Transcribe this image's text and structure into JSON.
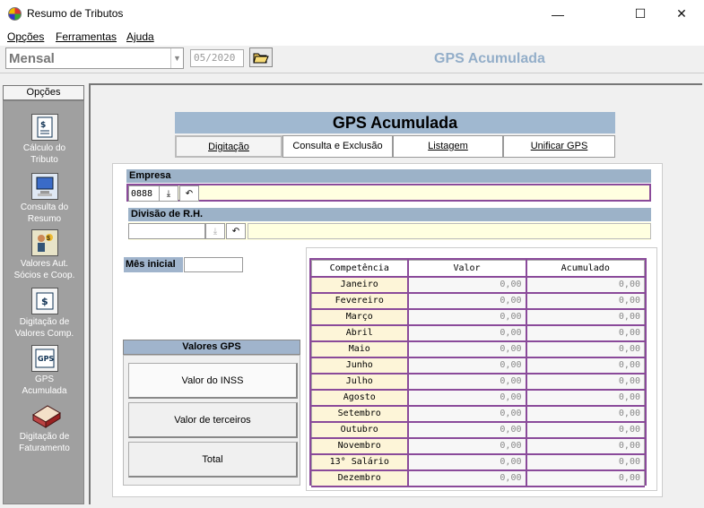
{
  "window": {
    "title": "Resumo de Tributos"
  },
  "menu": [
    "Opções",
    "Ferramentas",
    "Ajuda"
  ],
  "toolbar": {
    "period_type": "Mensal",
    "date": "05/2020",
    "title": "GPS Acumulada"
  },
  "sidebar": {
    "tab": "Opções",
    "items": [
      {
        "label_1": "Cálculo do",
        "label_2": "Tributo"
      },
      {
        "label_1": "Consulta do",
        "label_2": "Resumo"
      },
      {
        "label_1": "Valores Aut.",
        "label_2": "Sócios e  Coop."
      },
      {
        "label_1": "Digitação de",
        "label_2": "Valores Comp."
      },
      {
        "label_1": "GPS",
        "label_2": "Acumulada"
      },
      {
        "label_1": "Digitação de",
        "label_2": "Faturamento"
      }
    ]
  },
  "main": {
    "title": "GPS Acumulada",
    "tabs": [
      "Digitação",
      "Consulta e Exclusão",
      "Listagem",
      "Unificar GPS"
    ],
    "empresa_label": "Empresa",
    "empresa_code": "0888",
    "divisao_label": "Divisão de R.H.",
    "mes_inicial_label": "Mês inicial",
    "valores_gps_header": "Valores GPS",
    "valores_gps_buttons": [
      "Valor do INSS",
      "Valor de terceiros",
      "Total"
    ],
    "table_headers": [
      "Competência",
      "Valor",
      "Acumulado"
    ],
    "rows": [
      {
        "month": "Janeiro",
        "valor": "0,00",
        "acumulado": "0,00"
      },
      {
        "month": "Fevereiro",
        "valor": "0,00",
        "acumulado": "0,00"
      },
      {
        "month": "Março",
        "valor": "0,00",
        "acumulado": "0,00"
      },
      {
        "month": "Abril",
        "valor": "0,00",
        "acumulado": "0,00"
      },
      {
        "month": "Maio",
        "valor": "0,00",
        "acumulado": "0,00"
      },
      {
        "month": "Junho",
        "valor": "0,00",
        "acumulado": "0,00"
      },
      {
        "month": "Julho",
        "valor": "0,00",
        "acumulado": "0,00"
      },
      {
        "month": "Agosto",
        "valor": "0,00",
        "acumulado": "0,00"
      },
      {
        "month": "Setembro",
        "valor": "0,00",
        "acumulado": "0,00"
      },
      {
        "month": "Outubro",
        "valor": "0,00",
        "acumulado": "0,00"
      },
      {
        "month": "Novembro",
        "valor": "0,00",
        "acumulado": "0,00"
      },
      {
        "month": "13° Salário",
        "valor": "0,00",
        "acumulado": "0,00"
      },
      {
        "month": "Dezembro",
        "valor": "0,00",
        "acumulado": "0,00"
      }
    ]
  },
  "colors": {
    "accent": "#8a4a9a",
    "header_blue": "#a0b8d0",
    "input_yellow": "#ffffe0"
  }
}
